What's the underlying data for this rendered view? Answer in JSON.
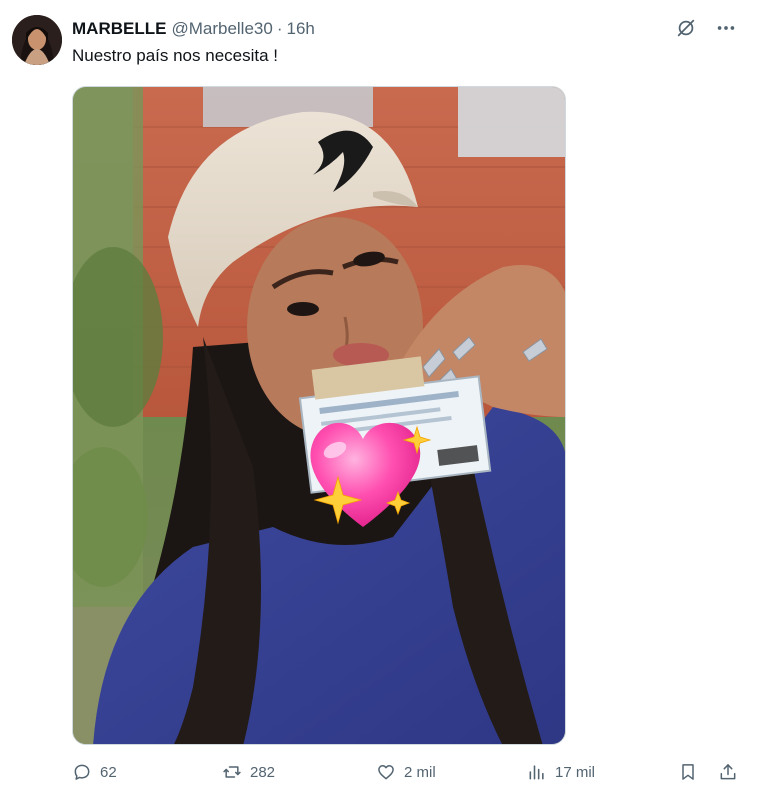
{
  "author": {
    "display_name": "MARBELLE",
    "handle": "@Marbelle30",
    "separator": "·",
    "time": "16h"
  },
  "icons": {
    "avatar": "avatar-image",
    "grok": "slashed-circle-icon",
    "more": "more-horizontal-icon",
    "reply": "reply-icon",
    "repost": "repost-icon",
    "like": "heart-outline-icon",
    "views": "views-bar-icon",
    "bookmark": "bookmark-icon",
    "share": "share-icon",
    "sticker": "sparkling-heart-emoji"
  },
  "tweet": {
    "text": "Nuestro país nos necesita !"
  },
  "actions": {
    "replies": "62",
    "reposts": "282",
    "likes": "2 mil",
    "views": "17 mil"
  },
  "colors": {
    "text_primary": "#0f1419",
    "text_secondary": "#536471",
    "border": "#cfd9de",
    "heart_sticker": "#ff4fb0"
  }
}
